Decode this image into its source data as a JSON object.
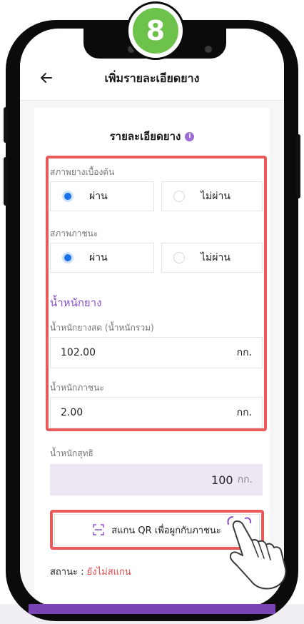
{
  "step": {
    "number": "8"
  },
  "header": {
    "title": "เพิ่มรายละเอียดยาง"
  },
  "card": {
    "title": "รายละเอียดยาง"
  },
  "initial_condition": {
    "label": "สภาพยางเบื้องต้น",
    "options": [
      "ผ่าน",
      "ไม่ผ่าน"
    ],
    "selected": "ผ่าน"
  },
  "container_condition": {
    "label": "สภาพภาชนะ",
    "options": [
      "ผ่าน",
      "ไม่ผ่าน"
    ],
    "selected": "ผ่าน"
  },
  "weight": {
    "section_title": "น้ำหนักยาง",
    "fresh_label": "น้ำหนักยางสด (น้ำหนักรวม)",
    "fresh_value": "102.00",
    "fresh_unit": "กก.",
    "container_label": "น้ำหนักภาชนะ",
    "container_value": "2.00",
    "container_unit": "กก."
  },
  "net": {
    "label": "น้ำหนักสุทธิ",
    "value": "100",
    "unit": "กก."
  },
  "scan": {
    "label": "สแกน QR เพื่อผูกกับภาชนะ",
    "icon": "qr-scan-icon"
  },
  "status": {
    "label": "สถานะ : ",
    "value": "ยังไม่สแกน"
  },
  "colors": {
    "accent": "#8a4fc6",
    "radio": "#1a73e8",
    "highlight": "#ea5a5a",
    "step_badge": "#6cc24a",
    "status_warning": "#e24a4a"
  }
}
